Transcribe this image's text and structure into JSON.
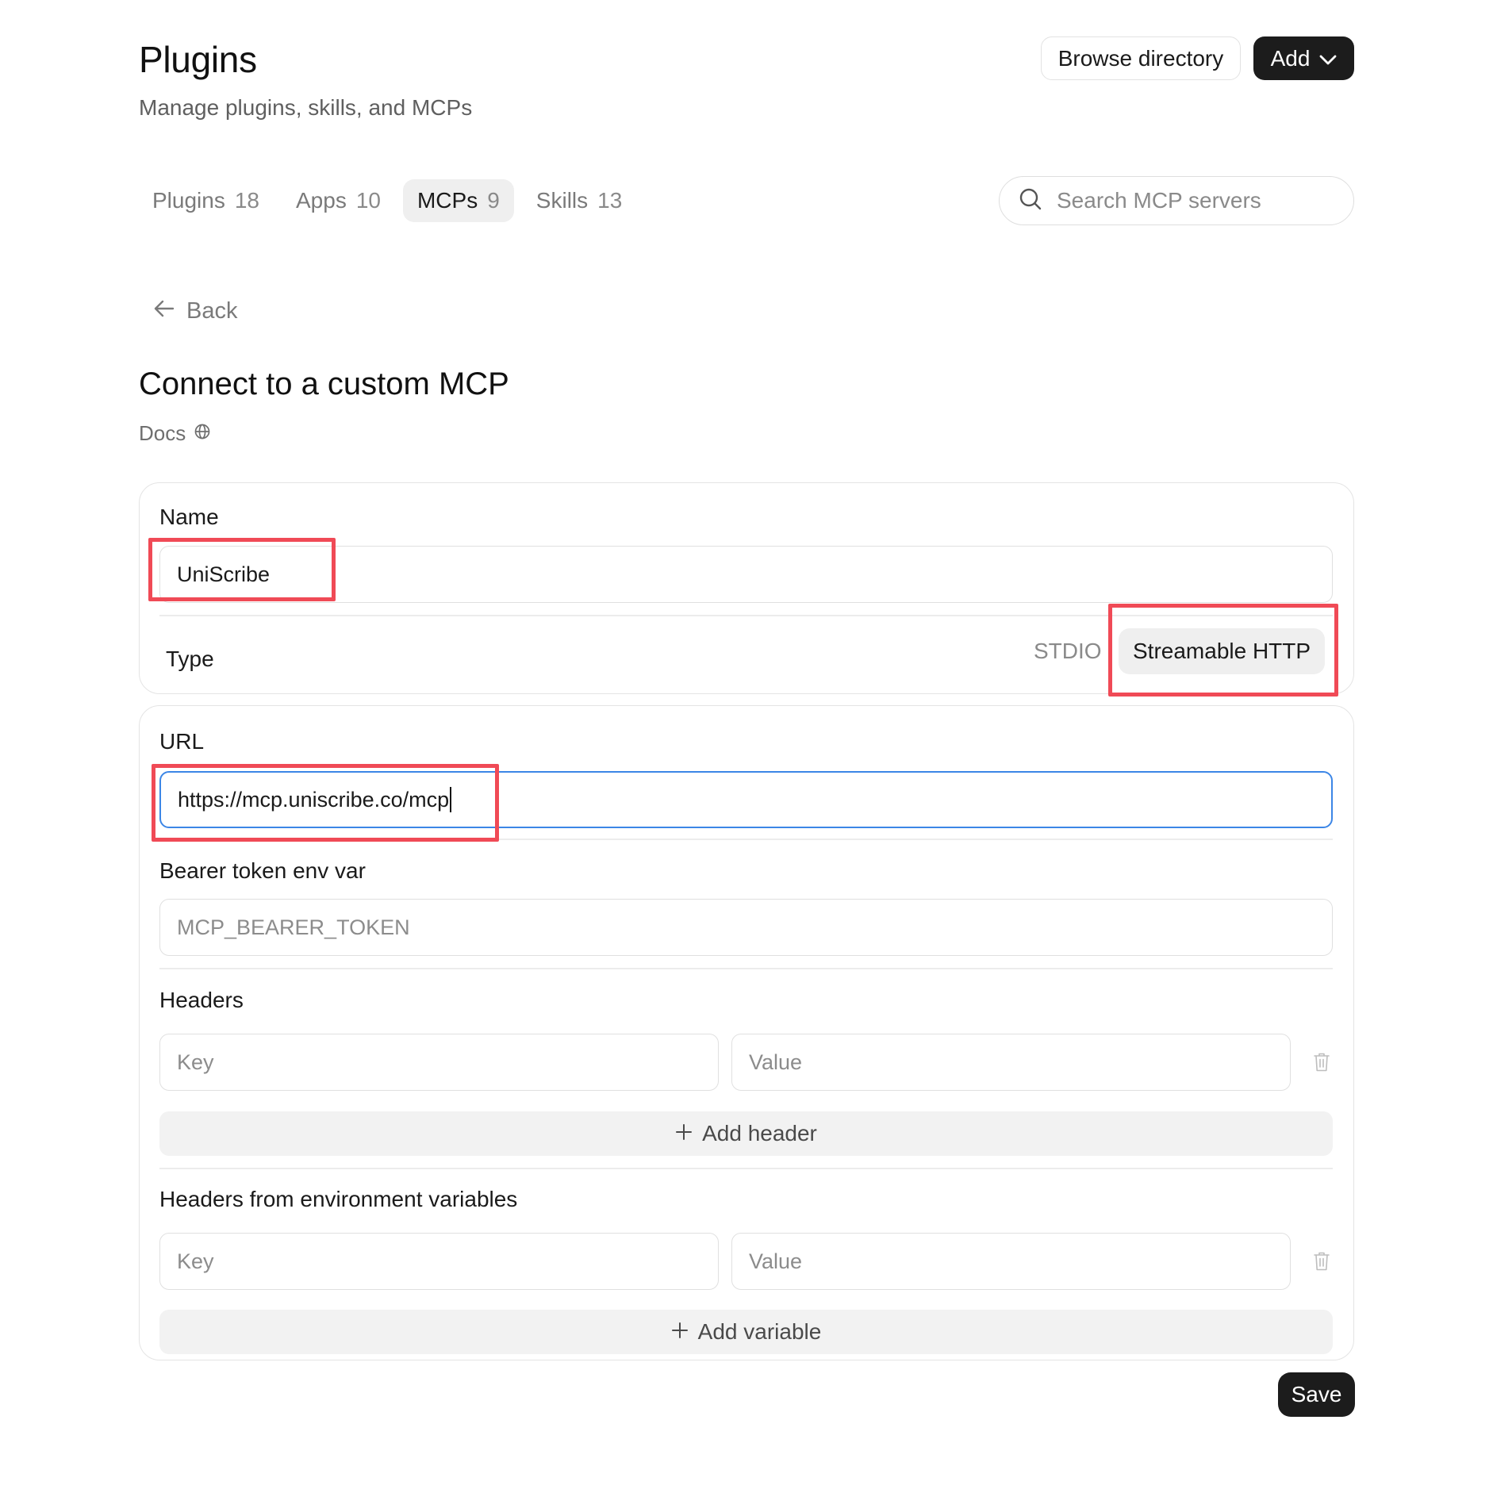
{
  "header": {
    "title": "Plugins",
    "subtitle": "Manage plugins, skills, and MCPs",
    "browse_label": "Browse directory",
    "add_label": "Add"
  },
  "tabs": [
    {
      "label": "Plugins",
      "count": "18",
      "active": false
    },
    {
      "label": "Apps",
      "count": "10",
      "active": false
    },
    {
      "label": "MCPs",
      "count": "9",
      "active": true
    },
    {
      "label": "Skills",
      "count": "13",
      "active": false
    }
  ],
  "search": {
    "placeholder": "Search MCP servers"
  },
  "nav": {
    "back_label": "Back"
  },
  "form": {
    "title": "Connect to a custom MCP",
    "docs_label": "Docs",
    "name_label": "Name",
    "name_value": "UniScribe",
    "type_label": "Type",
    "type_options": [
      "STDIO",
      "Streamable HTTP"
    ],
    "type_selected": "Streamable HTTP",
    "url_label": "URL",
    "url_value": "https://mcp.uniscribe.co/mcp",
    "bearer_label": "Bearer token env var",
    "bearer_placeholder": "MCP_BEARER_TOKEN",
    "headers_label": "Headers",
    "key_placeholder": "Key",
    "value_placeholder": "Value",
    "add_header_label": "Add header",
    "env_headers_label": "Headers from environment variables",
    "add_variable_label": "Add variable",
    "save_label": "Save"
  },
  "colors": {
    "accent_focus": "#3c86e6",
    "highlight": "#f04a56",
    "primary_button": "#1c1c1c"
  }
}
